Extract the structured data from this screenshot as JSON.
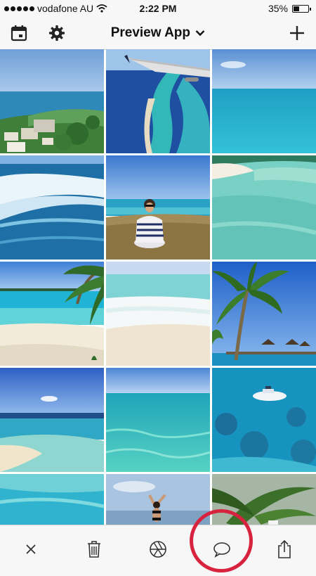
{
  "status_bar": {
    "carrier": "vodafone AU",
    "time": "2:22 PM",
    "battery": "35%",
    "battery_level": 0.35
  },
  "nav": {
    "title": "Preview App",
    "left_icons": [
      "calendar-icon",
      "gear-icon"
    ],
    "right_icon": "plus-icon"
  },
  "grid": {
    "photos": [
      "aerial-coast-town",
      "airplane-wing-reef",
      "turquoise-sea-horizon",
      "breaking-waves",
      "woman-sitting-grass-sea",
      "shallow-lagoon-beach",
      "palm-beach-shore",
      "white-foam-beach",
      "palm-tree-overwater-bungalows",
      "sandbar-beach",
      "clear-turquoise-water",
      "white-boat-reef",
      "shallow-blue-water",
      "woman-jumping-beach",
      "palm-fronds-shade"
    ]
  },
  "toolbar": {
    "icons": [
      "close-icon",
      "trash-icon",
      "aperture-icon",
      "comment-icon",
      "share-icon"
    ]
  },
  "annotation": {
    "highlight_color": "#d8233f",
    "highlight_target": "comment-icon"
  }
}
